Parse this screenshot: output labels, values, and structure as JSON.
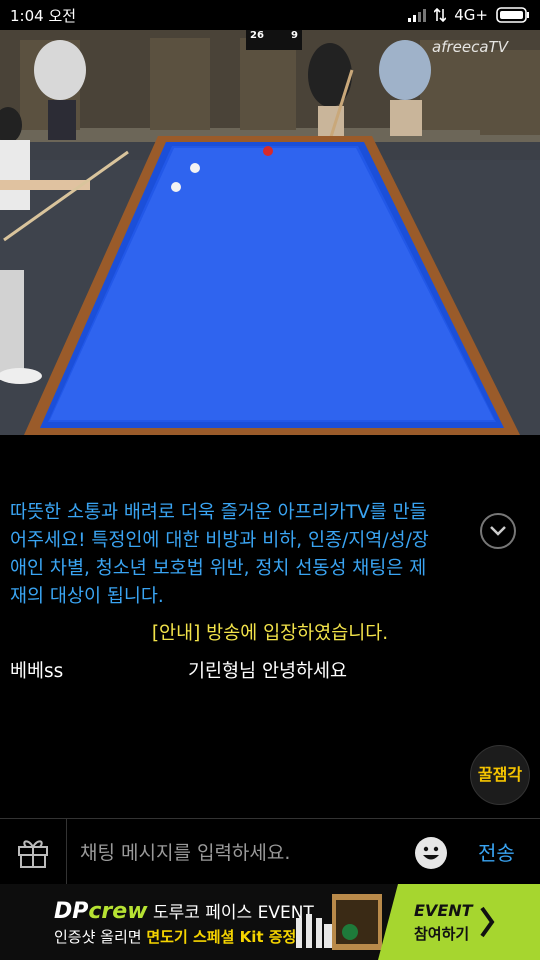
{
  "status_bar": {
    "time": "1:04 오전",
    "network": "4G+"
  },
  "stream": {
    "watermark": "afreecaTV",
    "scoreboard": [
      "26",
      "9"
    ]
  },
  "chat": {
    "notice": "따뜻한 소통과 배려로 더욱 즐거운 아프리카TV를 만들어주세요! 특정인에 대한 비방과 비하, 인종/지역/성/장애인 차별, 청소년 보호법 위반, 정치 선동성 채팅은 제재의 대상이 됩니다.",
    "system_message": "[안내] 방송에 입장하였습니다.",
    "messages": [
      {
        "user": "베베ss",
        "text": "기린형님 안녕하세요"
      }
    ],
    "honey_badge": "꿀잼각"
  },
  "input": {
    "placeholder": "채팅 메시지를 입력하세요.",
    "send_label": "전송"
  },
  "ad": {
    "brand_dp": "DP",
    "brand_crew": "crew",
    "title": "도루코 페이스 EVENT",
    "line2_prefix": "인증샷 올리면 ",
    "line2_highlight": "면도기 스페셜 Kit 증정!",
    "cta_line1": "EVENT",
    "cta_line2": "참여하기"
  },
  "colors": {
    "accent": "#3aa4f2",
    "system_text": "#f2e34a",
    "table_felt": "#1b4fd9"
  }
}
